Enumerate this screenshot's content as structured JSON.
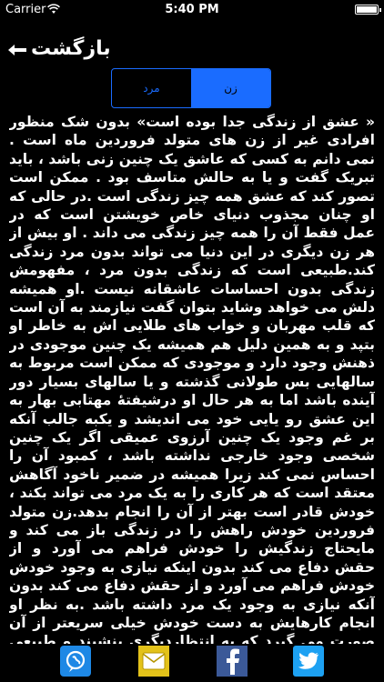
{
  "status_bar": {
    "carrier": "Carrier",
    "time": "5:40 PM",
    "wifi_icon": "wifi-icon",
    "battery_icon": "battery-icon"
  },
  "header": {
    "back_label": "بازگشت",
    "back_icon": "arrow-left-icon"
  },
  "segments": {
    "female_label": "زن",
    "male_label": "مرد",
    "selected": "زن",
    "accent_color": "#1a6cff"
  },
  "article": {
    "text": "« عشق از زندگی جدا بوده است» بدون شک منظور افرادی غیر از زن های متولد فروردین ماه است . نمی دانم به کسی که عاشق یک چنین زنی باشد ، باید تبریک گفت و یا به حالش متاسف بود . ممکن است تصور کند که عشق همه چیز زندگی است .در حالی که او چنان مجذوب دنیای خاص خویشتن است که در عمل فقط آن را همه چیز زندگی می داند . او بیش از هر زن دیگری در این دنیا می تواند بدون مرد زندگی کند.طبیعی است که زندگی بدون مرد ، مفهومش زندگی بدون احساسات عاشقانه نیست .او همیشه دلش می خواهد وشاید بتوان گفت نیازمند به آن است که قلب مهربان و خواب های طلایی اش به خاطر او بتپد و به همین دلیل هم همیشه یک چنین موجودی در ذهنش وجود دارد و موجودی که ممکن است مربوط به سالهایی بس طولانی گذشته و یا سالهای بسیار دور آینده باشد اما به هر حال او درشیفتهٔ مهتابی بهار به این عشق رو یایی خود می اندیشد و یکبه جالب آنکه بر غم وجود یک چنین آرزوی عمیقی اگر یک چنین شخصی وجود خارجی نداشته باشد ، کمبود آن را احساس نمی کند زیرا همیشه در ضمیر ناخود آگاهش معتقد است که هر کاری را به یک مرد می تواند بکند ، خودش قادر است بهتر از آن را انجام بدهد.زن متولد فروردین خودش راهش را در زندگی باز می کند و مایحتاج زندگیش را خودش فراهم می آورد و از حقش دفاع می کند بدون اینکه نیازی به وجود خودش خودش فراهم می آورد و از حقش دفاع می کند بدون آنکه نیازی به وجود یک مرد داشته باشد .به نظر او انجام کارهایش به دست خودش خیلی سریعتر از آن صورت می گیرد که به انتظاردیگری بنشیند و طبیعی است که یک چنین خصوصیاتی به مزاج مغرور مردها خوش آیند نیست . زن متولد فروردین مثل مرد متولد این ماه خواهان رهبری"
  },
  "share": {
    "viber_icon": "viber-icon",
    "mail_icon": "mail-icon",
    "facebook_icon": "facebook-icon",
    "twitter_icon": "twitter-icon",
    "viber_color": "#1e88e5",
    "mail_color": "#e3c21a",
    "facebook_color": "#3b5998",
    "twitter_color": "#1da1f2"
  }
}
